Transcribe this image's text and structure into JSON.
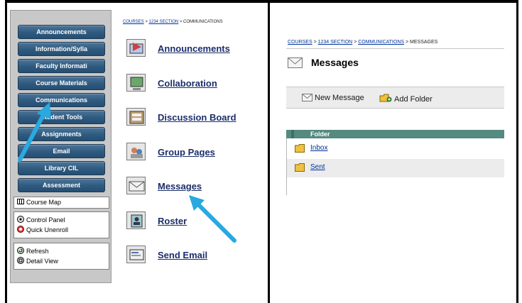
{
  "left_panel": {
    "nav_buttons": [
      "Announcements",
      "Information/Sylla",
      "Faculty Informati",
      "Course Materials",
      "Communications",
      "Student Tools",
      "Assignments",
      "Email",
      "Library CIL",
      "Assessment"
    ],
    "tools": {
      "course_map": "Course Map",
      "control_panel": "Control Panel",
      "quick_unenroll": "Quick Unenroll",
      "refresh": "Refresh",
      "detail_view": "Detail View"
    },
    "breadcrumb": {
      "courses": "COURSES",
      "section": "1234 SECTION",
      "current": "COMMUNICATIONS",
      "sep": " > "
    },
    "area_menu": [
      {
        "label": "Announcements",
        "icon": "announcements-icon"
      },
      {
        "label": "Collaboration",
        "icon": "collaboration-icon"
      },
      {
        "label": "Discussion Board",
        "icon": "discussion-board-icon"
      },
      {
        "label": "Group Pages",
        "icon": "group-pages-icon"
      },
      {
        "label": "Messages",
        "icon": "envelope-icon"
      },
      {
        "label": "Roster",
        "icon": "roster-icon"
      },
      {
        "label": "Send Email",
        "icon": "send-email-icon"
      }
    ]
  },
  "right_panel": {
    "breadcrumb": {
      "courses": "COURSES",
      "section": "1234 SECTION",
      "communications": "COMMUNICATIONS",
      "current": "MESSAGES",
      "sep": " > "
    },
    "title": "Messages",
    "actions": {
      "new_message": "New Message",
      "add_folder": "Add Folder"
    },
    "table": {
      "header": "Folder",
      "rows": [
        "Inbox",
        "Sent"
      ]
    }
  },
  "colors": {
    "nav_button": "#2f5a7f",
    "link": "#1b2e6b",
    "table_header": "#548a80",
    "arrow": "#29a9e0"
  }
}
